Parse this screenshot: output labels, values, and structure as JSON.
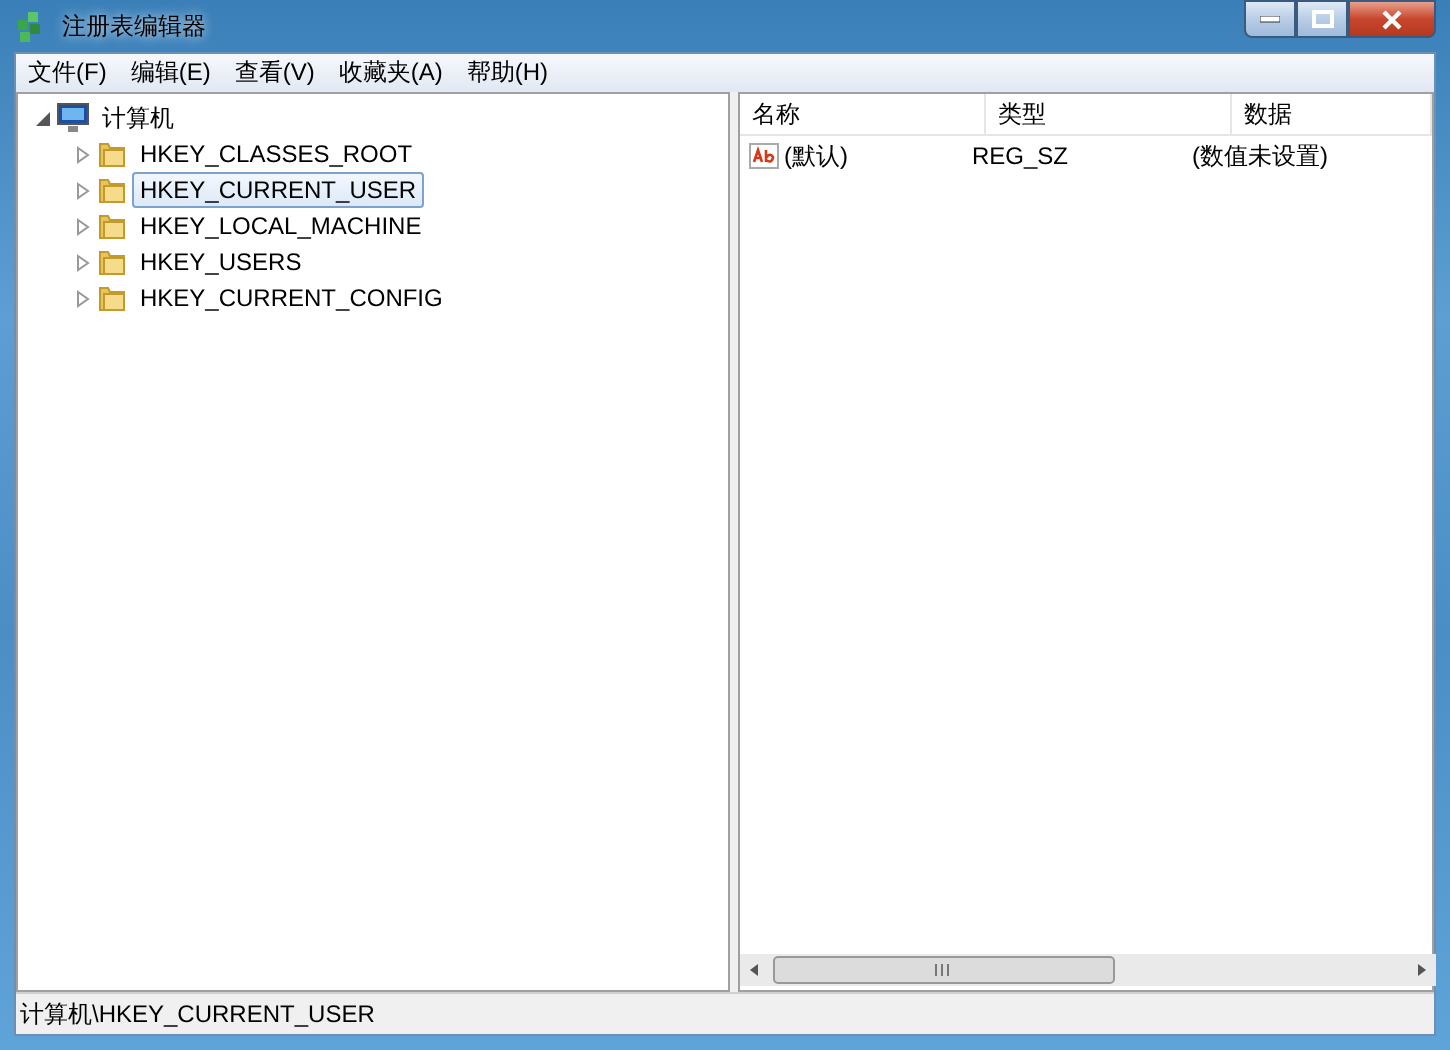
{
  "window": {
    "title": "注册表编辑器"
  },
  "menu": [
    "文件(F)",
    "编辑(E)",
    "查看(V)",
    "收藏夹(A)",
    "帮助(H)"
  ],
  "tree": [
    {
      "label": "计算机",
      "kind": "computer",
      "expanded": true,
      "selected": false,
      "children": [
        {
          "label": "HKEY_CLASSES_ROOT",
          "kind": "folder",
          "expanded": false,
          "selected": false
        },
        {
          "label": "HKEY_CURRENT_USER",
          "kind": "folder",
          "expanded": false,
          "selected": true
        },
        {
          "label": "HKEY_LOCAL_MACHINE",
          "kind": "folder",
          "expanded": false,
          "selected": false
        },
        {
          "label": "HKEY_USERS",
          "kind": "folder",
          "expanded": false,
          "selected": false
        },
        {
          "label": "HKEY_CURRENT_CONFIG",
          "kind": "folder",
          "expanded": false,
          "selected": false
        }
      ]
    }
  ],
  "list": {
    "columns": [
      "名称",
      "类型",
      "数据"
    ],
    "rows": [
      {
        "kind": "string",
        "cells": [
          "(默认)",
          "REG_SZ",
          "(数值未设置)"
        ]
      }
    ]
  },
  "status_bar": "计算机\\HKEY_CURRENT_USER"
}
